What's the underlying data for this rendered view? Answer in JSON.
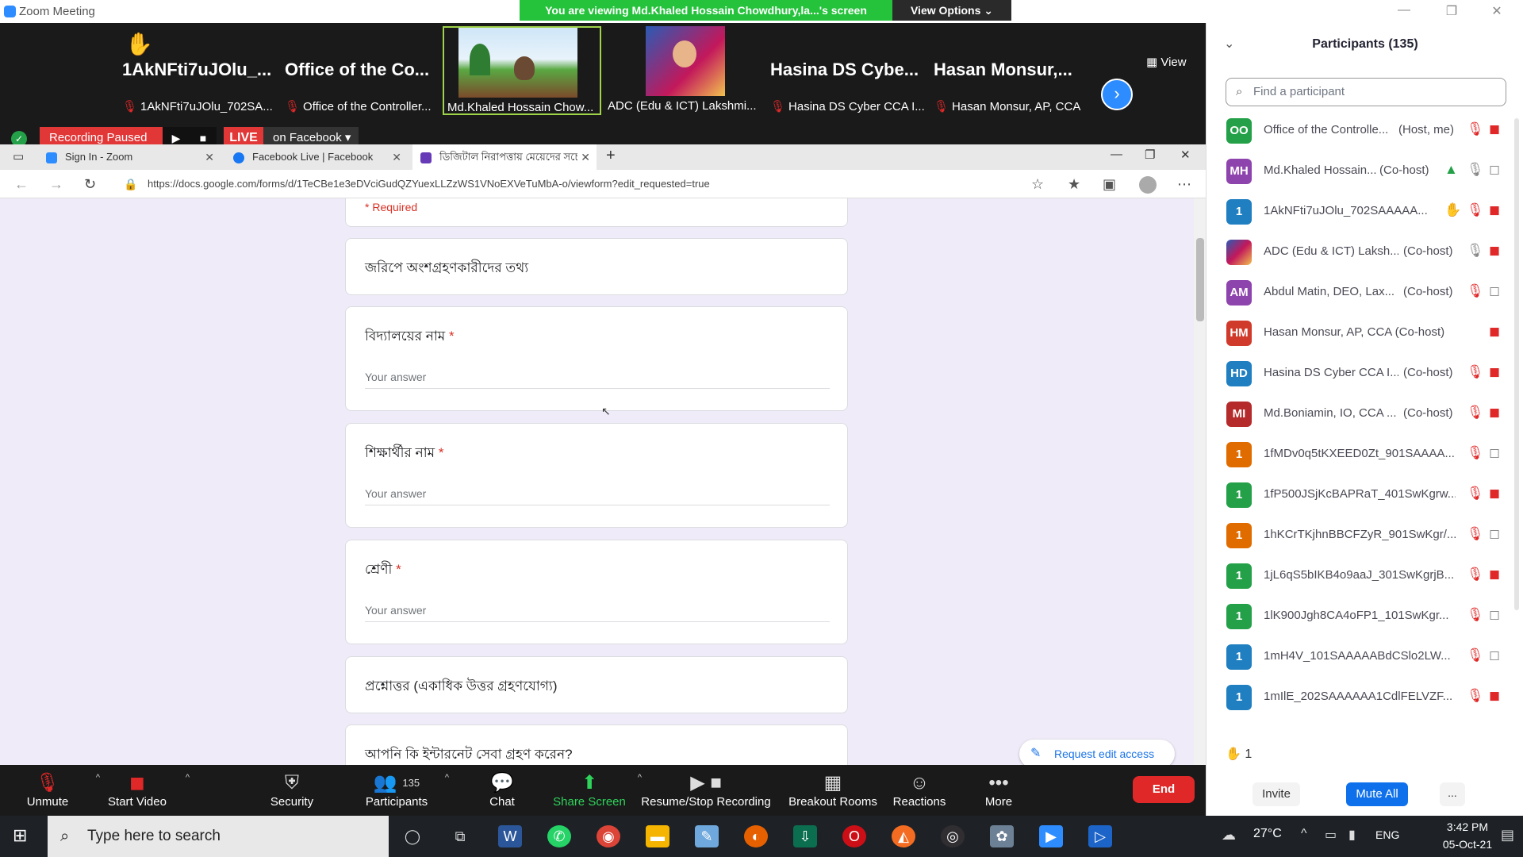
{
  "window": {
    "title": "Zoom Meeting",
    "share_banner": "You are viewing Md.Khaled Hossain Chowdhury,la...'s screen",
    "view_options": "View Options"
  },
  "video_strip": {
    "view_label": "View",
    "tiles": [
      {
        "name": "1AkNFti7uJOlu_...",
        "label": "1AkNFti7uJOlu_702SA..."
      },
      {
        "name": "Office of the Co...",
        "label": "Office of the Controller..."
      },
      {
        "name": "",
        "label": "Md.Khaled Hossain Chow..."
      },
      {
        "name": "",
        "label": "ADC (Edu & ICT) Lakshmi..."
      },
      {
        "name": "Hasina DS Cybe...",
        "label": "Hasina DS Cyber CCA I..."
      },
      {
        "name": "Hasan Monsur,...",
        "label": "Hasan Monsur, AP, CCA"
      }
    ]
  },
  "recording": {
    "status": "Recording Paused",
    "live": "LIVE",
    "destination": "on Facebook"
  },
  "browser": {
    "tabs": [
      {
        "label": "Sign In - Zoom",
        "favicon_color": "#2d8cff"
      },
      {
        "label": "Facebook Live | Facebook",
        "favicon_color": "#1877f2"
      },
      {
        "label": "ডিজিটাল নিরাপত্তায় মেয়েদের সচে",
        "favicon_color": "#673ab7"
      }
    ],
    "url": "https://docs.google.com/forms/d/1TeCBe1e3eDVciGudQZYuexLLZzWS1VNoEXVeTuMbA-o/viewform?edit_requested=true"
  },
  "form": {
    "required_note": "* Required",
    "section_title": "জরিপে অংশগ্রহণকারীদের তথ্য",
    "questions": [
      {
        "label": "বিদ্যালয়ের নাম",
        "required": "*",
        "placeholder": "Your answer"
      },
      {
        "label": "শিক্ষার্থীর নাম",
        "required": "*",
        "placeholder": "Your answer"
      },
      {
        "label": "শ্রেণী",
        "required": "*",
        "placeholder": "Your answer"
      }
    ],
    "section2_title": "প্রশ্নোত্তর (একাধিক উত্তর গ্রহণযোগ্য)",
    "next_question": "আপনি কি ইন্টারনেট সেবা গ্রহণ করেন?",
    "request_edit": "Request edit access"
  },
  "toolbar": {
    "unmute": "Unmute",
    "start_video": "Start Video",
    "security": "Security",
    "participants": "Participants",
    "participants_count": "135",
    "chat": "Chat",
    "share_screen": "Share Screen",
    "recording": "Resume/Stop Recording",
    "breakout": "Breakout Rooms",
    "reactions": "Reactions",
    "more": "More",
    "end": "End"
  },
  "participants_panel": {
    "title": "Participants (135)",
    "search_placeholder": "Find a participant",
    "participants": [
      {
        "initials": "OO",
        "color": "#24a148",
        "name": "Office of the Controlle...",
        "role": "(Host, me)"
      },
      {
        "initials": "MH",
        "color": "#8e44ad",
        "name": "Md.Khaled Hossain...",
        "role": "(Co-host)"
      },
      {
        "initials": "1",
        "color": "#1f7fc1",
        "name": "1AkNFti7uJOlu_702SAAAAA...",
        "role": ""
      },
      {
        "initials": "",
        "color": "#c2185b",
        "name": "ADC (Edu & ICT) Laksh...",
        "role": "(Co-host)"
      },
      {
        "initials": "AM",
        "color": "#8e44ad",
        "name": "Abdul Matin, DEO, Lax...",
        "role": "(Co-host)"
      },
      {
        "initials": "HM",
        "color": "#d03a2a",
        "name": "Hasan Monsur, AP, CCA (Co-host)",
        "role": ""
      },
      {
        "initials": "HD",
        "color": "#1f7fc1",
        "name": "Hasina DS Cyber CCA I...",
        "role": "(Co-host)"
      },
      {
        "initials": "MI",
        "color": "#b52a2a",
        "name": "Md.Boniamin, IO, CCA ...",
        "role": "(Co-host)"
      },
      {
        "initials": "1",
        "color": "#e06c00",
        "name": "1fMDv0q5tKXEED0Zt_901SAAAA...",
        "role": ""
      },
      {
        "initials": "1",
        "color": "#24a148",
        "name": "1fP500JSjKcBAPRaT_401SwKgrw...",
        "role": ""
      },
      {
        "initials": "1",
        "color": "#e06c00",
        "name": "1hKCrTKjhnBBCFZyR_901SwKgr/...",
        "role": ""
      },
      {
        "initials": "1",
        "color": "#24a148",
        "name": "1jL6qS5bIKB4o9aaJ_301SwKgrjB...",
        "role": ""
      },
      {
        "initials": "1",
        "color": "#24a148",
        "name": "1lK900Jgh8CA4oFP1_101SwKgr...",
        "role": ""
      },
      {
        "initials": "1",
        "color": "#1f7fc1",
        "name": "1mH4V_101SAAAAABdCSlo2LW...",
        "role": ""
      },
      {
        "initials": "1",
        "color": "#1f7fc1",
        "name": "1mIlE_202SAAAAAA1CdlFELVZF...",
        "role": ""
      }
    ],
    "raised_count": "1",
    "invite": "Invite",
    "mute_all": "Mute All",
    "more": "..."
  },
  "taskbar": {
    "search_placeholder": "Type here to search",
    "weather": "27°C",
    "language": "ENG",
    "time": "3:42 PM",
    "date": "05-Oct-21"
  }
}
